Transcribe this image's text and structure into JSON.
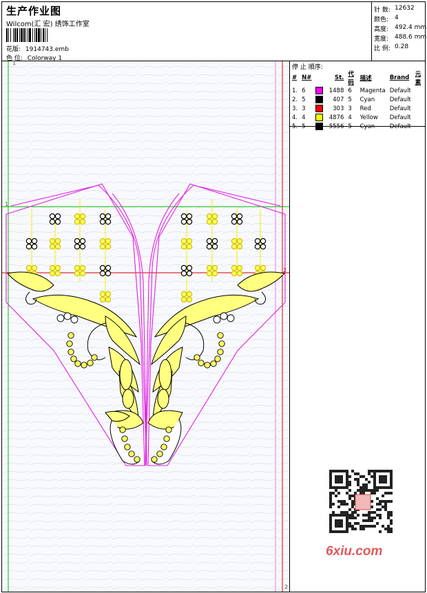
{
  "header": {
    "title": "生产作业图",
    "studio": "Wilcom(汇 宏) 绣饰工作室",
    "design_label": "花版:",
    "design_value": "1914743.emb",
    "colorway_label": "色 位:",
    "colorway_value": "Colorway 1"
  },
  "stats": [
    {
      "label": "针 数:",
      "value": "12632"
    },
    {
      "label": "颜色:",
      "value": "4"
    },
    {
      "label": "高度:",
      "value": "492.4 mm"
    },
    {
      "label": "宽度:",
      "value": "488.6 mm"
    },
    {
      "label": "比 例:",
      "value": "0.28"
    }
  ],
  "stop_sequence": {
    "title": "停 止 顺序:",
    "headers": [
      "#",
      "N#",
      "St.",
      "代码",
      "描述",
      "Brand",
      "元素"
    ],
    "rows": [
      {
        "idx": "1.",
        "n": "6",
        "color": "#ff00ff",
        "st": "1488",
        "code": "6",
        "desc": "Magenta",
        "brand": "Default"
      },
      {
        "idx": "2.",
        "n": "5",
        "color": "#000000",
        "st": "407",
        "code": "5",
        "desc": "Cyan",
        "brand": "Default"
      },
      {
        "idx": "3.",
        "n": "3",
        "color": "#ff0000",
        "st": "303",
        "code": "3",
        "desc": "Red",
        "brand": "Default"
      },
      {
        "idx": "4.",
        "n": "4",
        "color": "#ffff00",
        "st": "4876",
        "code": "4",
        "desc": "Yellow",
        "brand": "Default"
      },
      {
        "idx": "5.",
        "n": "5",
        "color": "#000000",
        "st": "5556",
        "code": "5",
        "desc": "Cyan",
        "brand": "Default"
      }
    ]
  },
  "canvas_marks": {
    "top_left": "1",
    "left_mid": "1",
    "right_mid": "2",
    "bottom_right": "2"
  },
  "watermark": {
    "brand": "6xiu.com"
  },
  "colors": {
    "outline": "#e020e0",
    "guide_red": "#e00000",
    "guide_green": "#00c000",
    "fill_yellow": "#ffff80",
    "stitch_yellow": "#f0f000"
  }
}
